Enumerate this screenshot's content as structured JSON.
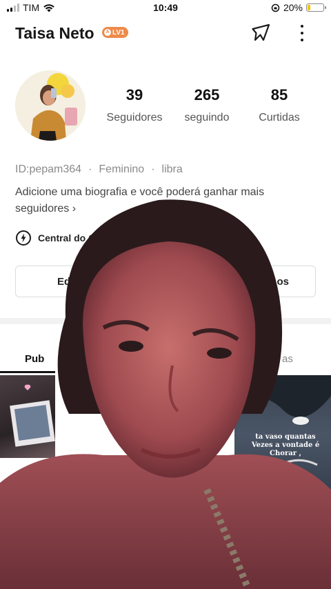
{
  "status_bar": {
    "carrier": "TIM",
    "time": "10:49",
    "battery_pct": "20%",
    "battery_level": 0.2
  },
  "header": {
    "username": "Taisa Neto",
    "level_badge": "LV1"
  },
  "stats": [
    {
      "value": "39",
      "label": "Seguidores"
    },
    {
      "value": "265",
      "label": "seguindo"
    },
    {
      "value": "85",
      "label": "Curtidas"
    }
  ],
  "profile": {
    "id": "ID:pepam364",
    "gender": "Feminino",
    "sign": "libra",
    "bio_line1": "Adicione uma biografia e você poderá ganhar mais",
    "bio_line2": "seguidores",
    "central_label": "Central do C"
  },
  "buttons": {
    "left_label": "Ed",
    "right_label": "os"
  },
  "tabs": {
    "first": "Pub",
    "last": "as"
  },
  "thumbnail_caption": "ta vaso quantas Vezes a vontade é Chorar ,",
  "colors": {
    "accent": "#ee8a4a",
    "battery": "#f2c500"
  }
}
